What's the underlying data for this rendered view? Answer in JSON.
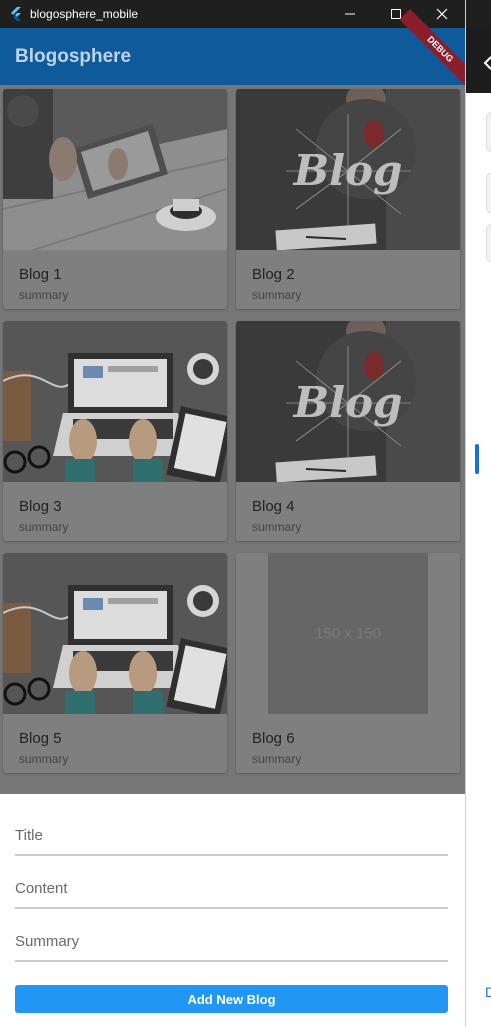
{
  "window": {
    "title": "blogosphere_mobile",
    "controls": [
      "minimize",
      "maximize",
      "close"
    ]
  },
  "appbar": {
    "title": "Blogosphere",
    "debug_banner": "DEBUG",
    "color": "#0f5a9a"
  },
  "blogs": [
    {
      "title": "Blog 1",
      "summary": "summary",
      "image": "tablet-coffee-photo"
    },
    {
      "title": "Blog 2",
      "summary": "summary",
      "image": "blog-cafe-photo"
    },
    {
      "title": "Blog 3",
      "summary": "summary",
      "image": "laptop-desk-illustration"
    },
    {
      "title": "Blog 4",
      "summary": "summary",
      "image": "blog-cafe-photo"
    },
    {
      "title": "Blog 5",
      "summary": "summary",
      "image": "laptop-desk-illustration"
    },
    {
      "title": "Blog 6",
      "summary": "summary",
      "image": "placeholder",
      "placeholder_text": "150 x 150"
    }
  ],
  "form": {
    "title_placeholder": "Title",
    "content_placeholder": "Content",
    "summary_placeholder": "Summary",
    "submit_label": "Add New Blog",
    "submit_color": "#2196f3"
  },
  "side_panel": {
    "visible_letter": "D"
  }
}
